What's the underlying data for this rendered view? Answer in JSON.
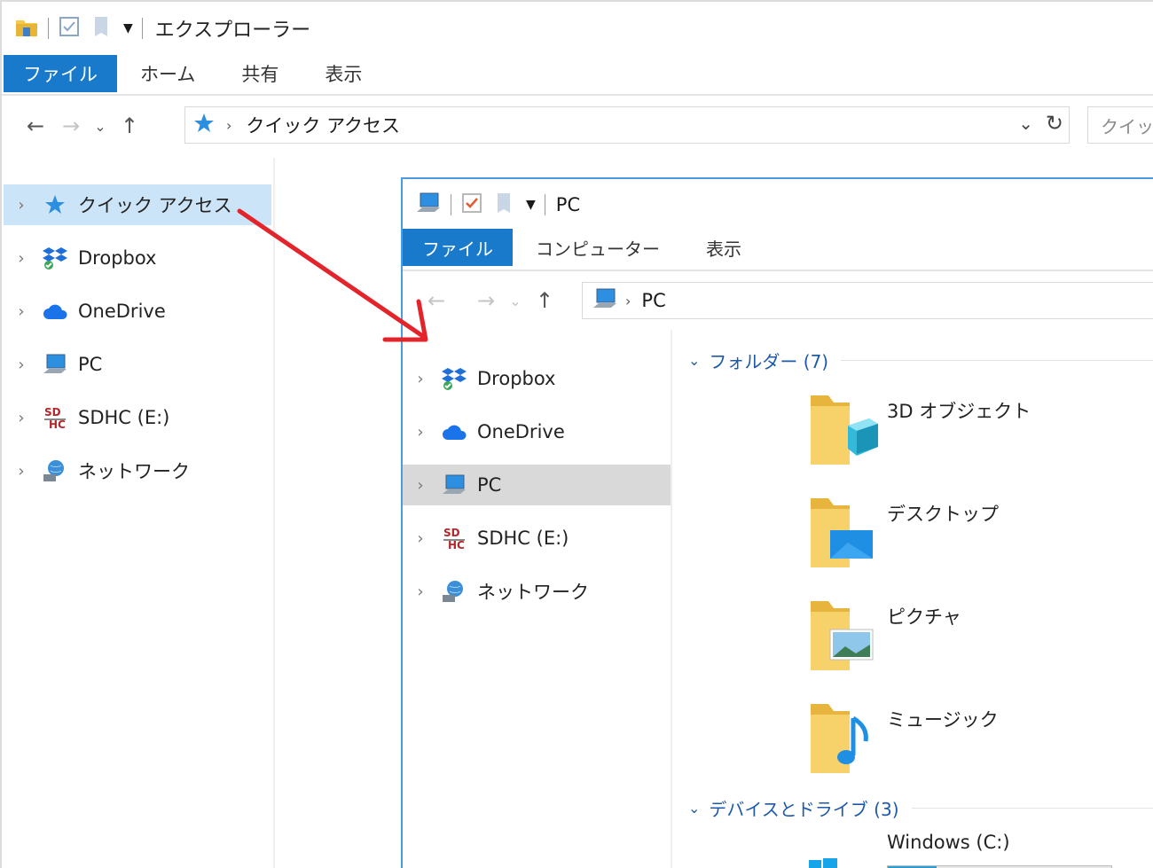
{
  "outer": {
    "title": "エクスプローラー",
    "tabs": [
      "ファイル",
      "ホーム",
      "共有",
      "表示"
    ],
    "address": {
      "location": "クイック アクセス"
    },
    "search_placeholder": "クイック",
    "nav_items": [
      {
        "label": "クイック アクセス",
        "icon": "star-icon",
        "selected": true
      },
      {
        "label": "Dropbox",
        "icon": "dropbox-icon"
      },
      {
        "label": "OneDrive",
        "icon": "cloud-icon"
      },
      {
        "label": "PC",
        "icon": "computer-icon"
      },
      {
        "label": "SDHC (E:)",
        "icon": "sd-card-icon"
      },
      {
        "label": "ネットワーク",
        "icon": "network-icon"
      }
    ]
  },
  "inner": {
    "title": "PC",
    "tabs": [
      "ファイル",
      "コンピューター",
      "表示"
    ],
    "address": {
      "location": "PC"
    },
    "nav_items": [
      {
        "label": "Dropbox",
        "icon": "dropbox-icon"
      },
      {
        "label": "OneDrive",
        "icon": "cloud-icon"
      },
      {
        "label": "PC",
        "icon": "computer-icon",
        "selected": true
      },
      {
        "label": "SDHC (E:)",
        "icon": "sd-card-icon"
      },
      {
        "label": "ネットワーク",
        "icon": "network-icon"
      }
    ],
    "groups": [
      {
        "label": "フォルダー (7)"
      },
      {
        "label": "デバイスとドライブ (3)"
      }
    ],
    "folders": [
      {
        "name": "3D オブジェクト",
        "icon": "3d-objects-folder-icon"
      },
      {
        "name": "デスクトップ",
        "icon": "desktop-folder-icon"
      },
      {
        "name": "ピクチャ",
        "icon": "pictures-folder-icon"
      },
      {
        "name": "ミュージック",
        "icon": "music-folder-icon"
      }
    ],
    "drives": [
      {
        "name": "Windows (C:)",
        "icon": "windows-drive-icon",
        "used_fraction": 0.22
      }
    ]
  },
  "colors": {
    "accent": "#1979ca",
    "selected_nav": "#cce4f7",
    "arrow": "#e3242b",
    "group_text": "#1e5aa8"
  }
}
